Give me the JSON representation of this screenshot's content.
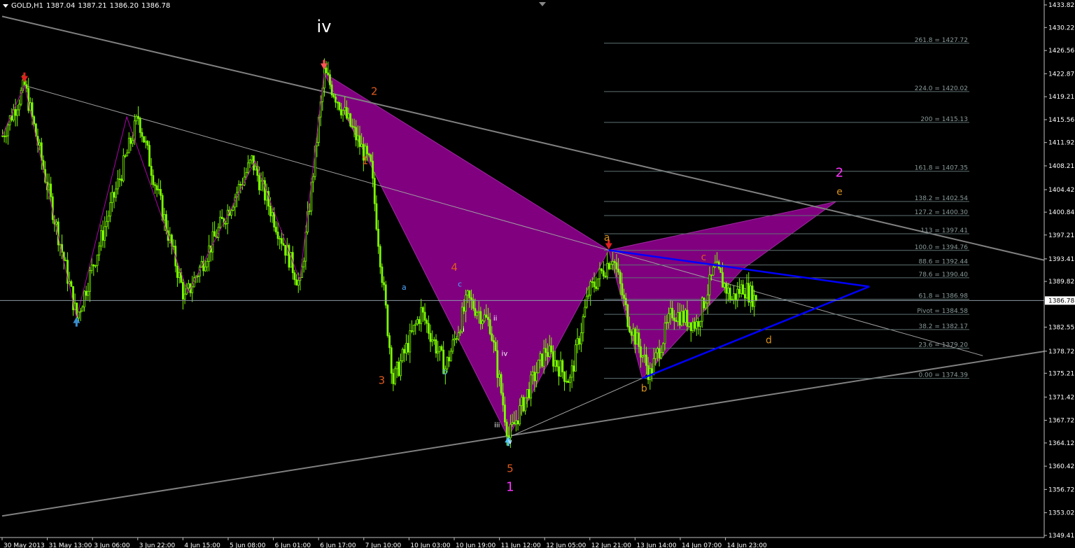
{
  "header": {
    "symbol": "GOLD,H1",
    "open": "1387.04",
    "high": "1387.21",
    "low": "1386.20",
    "close": "1386.78"
  },
  "colors": {
    "background": "#000000",
    "bull_candle": "#7CFC00",
    "harmonic_fill": "#800080",
    "trendline": "#808080",
    "triangle": "#0000FF",
    "fib_line": "#5f7272",
    "current_price_line": "#8c9aa6",
    "label_red": "#e05a1e",
    "label_orange": "#d9921a",
    "label_blue": "#4da6ff",
    "label_magenta": "#ff33ff",
    "arrow_red": "#e02020",
    "arrow_blue": "#3a8ccc",
    "arrow_cyan": "#4fc3f7"
  },
  "chart_data": {
    "type": "candlestick",
    "symbol": "GOLD",
    "timeframe": "H1",
    "ylim": [
      1349.41,
      1433.82
    ],
    "y_ticks": [
      "1433.82",
      "1430.22",
      "1426.56",
      "1422.87",
      "1419.21",
      "1415.56",
      "1411.92",
      "1408.21",
      "1404.42",
      "1400.84",
      "1397.21",
      "1393.41",
      "1389.82",
      "1386.78",
      "1382.55",
      "1378.72",
      "1375.21",
      "1371.42",
      "1367.72",
      "1364.12",
      "1360.42",
      "1356.72",
      "1353.02",
      "1349.41"
    ],
    "current_price": "1386.78",
    "x_ticks": [
      "30 May 2013",
      "31 May 13:00",
      "3 Jun 06:00",
      "3 Jun 22:00",
      "4 Jun 15:00",
      "5 Jun 08:00",
      "6 Jun 01:00",
      "6 Jun 17:00",
      "7 Jun 10:00",
      "10 Jun 03:00",
      "10 Jun 19:00",
      "11 Jun 12:00",
      "12 Jun 05:00",
      "12 Jun 21:00",
      "13 Jun 14:00",
      "14 Jun 07:00",
      "14 Jun 23:00"
    ],
    "price_path": [
      {
        "bar": 0,
        "price": 1413
      },
      {
        "bar": 12,
        "price": 1421
      },
      {
        "bar": 40,
        "price": 1384
      },
      {
        "bar": 73,
        "price": 1416
      },
      {
        "bar": 98,
        "price": 1387
      },
      {
        "bar": 134,
        "price": 1409
      },
      {
        "bar": 160,
        "price": 1389
      },
      {
        "bar": 173,
        "price": 1423
      },
      {
        "bar": 198,
        "price": 1408
      },
      {
        "bar": 205,
        "price": 1388
      },
      {
        "bar": 210,
        "price": 1374
      },
      {
        "bar": 225,
        "price": 1385
      },
      {
        "bar": 238,
        "price": 1376
      },
      {
        "bar": 250,
        "price": 1387
      },
      {
        "bar": 262,
        "price": 1383
      },
      {
        "bar": 272,
        "price": 1365
      },
      {
        "bar": 292,
        "price": 1379
      },
      {
        "bar": 305,
        "price": 1374
      },
      {
        "bar": 315,
        "price": 1388
      },
      {
        "bar": 328,
        "price": 1394
      },
      {
        "bar": 336,
        "price": 1384
      },
      {
        "bar": 348,
        "price": 1375
      },
      {
        "bar": 360,
        "price": 1385
      },
      {
        "bar": 373,
        "price": 1383
      },
      {
        "bar": 383,
        "price": 1392
      },
      {
        "bar": 392,
        "price": 1387
      },
      {
        "bar": 398,
        "price": 1389
      },
      {
        "bar": 405,
        "price": 1386.78
      }
    ],
    "fib_levels": [
      {
        "label": "261.8 = 1427.72",
        "price": 1427.72
      },
      {
        "label": "224.0 = 1420.02",
        "price": 1420.02
      },
      {
        "label": "200 = 1415.13",
        "price": 1415.13
      },
      {
        "label": "161.8 = 1407.35",
        "price": 1407.35
      },
      {
        "label": "138.2 = 1402.54",
        "price": 1402.54
      },
      {
        "label": "127.2 = 1400.30",
        "price": 1400.3
      },
      {
        "label": "113 = 1397.41",
        "price": 1397.41
      },
      {
        "label": "100.0 = 1394.76",
        "price": 1394.76
      },
      {
        "label": "88.6 = 1392.44",
        "price": 1392.44
      },
      {
        "label": "78.6 = 1390.40",
        "price": 1390.4
      },
      {
        "label": "61.8 = 1386.98",
        "price": 1386.98
      },
      {
        "label": "Pivot = 1384.58",
        "price": 1384.58
      },
      {
        "label": "38.2 = 1382.17",
        "price": 1382.17
      },
      {
        "label": "23.6 = 1379.20",
        "price": 1379.2
      },
      {
        "label": "0.00 = 1374.39",
        "price": 1374.39
      }
    ],
    "wave_labels": [
      {
        "text": "iv",
        "bar": 173,
        "price": 1429.5,
        "color": "#ffffff",
        "size": 24
      },
      {
        "text": "2",
        "bar": 200,
        "price": 1419.5,
        "color": "#e05a1e",
        "size": 15
      },
      {
        "text": "1",
        "bar": 195,
        "price": 1408.5,
        "color": "#e05a1e",
        "size": 15
      },
      {
        "text": "3",
        "bar": 204,
        "price": 1373.5,
        "color": "#e05a1e",
        "size": 15
      },
      {
        "text": "4",
        "bar": 243,
        "price": 1391.5,
        "color": "#e05a1e",
        "size": 15
      },
      {
        "text": "5",
        "bar": 273,
        "price": 1359.5,
        "color": "#e05a1e",
        "size": 15
      },
      {
        "text": "1",
        "bar": 273,
        "price": 1356.5,
        "color": "#ff33ff",
        "size": 18
      },
      {
        "text": "2",
        "bar": 450,
        "price": 1406.5,
        "color": "#ff33ff",
        "size": 18
      },
      {
        "text": "a",
        "bar": 216,
        "price": 1388.5,
        "color": "#4da6ff",
        "size": 11
      },
      {
        "text": "c",
        "bar": 246,
        "price": 1389.0,
        "color": "#4da6ff",
        "size": 11
      },
      {
        "text": "b",
        "bar": 238,
        "price": 1375.0,
        "color": "#4da6ff",
        "size": 11
      },
      {
        "text": "i",
        "bar": 248,
        "price": 1381.8,
        "color": "#ffffff",
        "size": 10
      },
      {
        "text": "ii",
        "bar": 265,
        "price": 1383.6,
        "color": "#ffffff",
        "size": 10
      },
      {
        "text": "iii",
        "bar": 266,
        "price": 1366.6,
        "color": "#ffffff",
        "size": 10
      },
      {
        "text": "iv",
        "bar": 270,
        "price": 1378.0,
        "color": "#ffffff",
        "size": 10
      },
      {
        "text": "v",
        "bar": 273,
        "price": 1364.0,
        "color": "#ffffff",
        "size": 10
      },
      {
        "text": "a",
        "bar": 325,
        "price": 1396.3,
        "color": "#d9921a",
        "size": 14
      },
      {
        "text": "b",
        "bar": 345,
        "price": 1372.3,
        "color": "#d9921a",
        "size": 14
      },
      {
        "text": "c",
        "bar": 377,
        "price": 1393.2,
        "color": "#e05a1e",
        "size": 14
      },
      {
        "text": "d",
        "bar": 412,
        "price": 1380.0,
        "color": "#d9921a",
        "size": 14
      },
      {
        "text": "e",
        "bar": 450,
        "price": 1403.6,
        "color": "#d9921a",
        "size": 14
      }
    ],
    "harmonic_patterns": [
      {
        "points": [
          {
            "bar": 173,
            "price": 1423
          },
          {
            "bar": 272,
            "price": 1365
          },
          {
            "bar": 200,
            "price": 1417
          }
        ]
      },
      {
        "points": [
          {
            "bar": 173,
            "price": 1423
          },
          {
            "bar": 272,
            "price": 1365
          },
          {
            "bar": 326,
            "price": 1394.8
          }
        ]
      },
      {
        "points": [
          {
            "bar": 326,
            "price": 1394.8
          },
          {
            "bar": 344,
            "price": 1374.4
          },
          {
            "bar": 398,
            "price": 1391.8
          }
        ]
      },
      {
        "points": [
          {
            "bar": 326,
            "price": 1394.8
          },
          {
            "bar": 448,
            "price": 1402.5
          },
          {
            "bar": 398,
            "price": 1391.8
          }
        ]
      }
    ],
    "trendlines": [
      {
        "from": {
          "bar": 0,
          "price": 1432
        },
        "to": {
          "bar": 560,
          "price": 1393.2
        },
        "color": "#808080",
        "width": 2
      },
      {
        "from": {
          "bar": 0,
          "price": 1352.5
        },
        "to": {
          "bar": 560,
          "price": 1378.7
        },
        "color": "#808080",
        "width": 2
      },
      {
        "from": {
          "bar": 12,
          "price": 1421
        },
        "to": {
          "bar": 527,
          "price": 1378.0
        },
        "color": "#a0a0a0",
        "width": 1
      },
      {
        "from": {
          "bar": 272,
          "price": 1365
        },
        "to": {
          "bar": 344,
          "price": 1374.4
        },
        "color": "#a0a0a0",
        "width": 1
      }
    ],
    "zigzag": [
      {
        "bar": 0,
        "price": 1413
      },
      {
        "bar": 12,
        "price": 1421
      },
      {
        "bar": 40,
        "price": 1384
      },
      {
        "bar": 67,
        "price": 1416
      },
      {
        "bar": 100,
        "price": 1388
      },
      {
        "bar": 136,
        "price": 1409
      },
      {
        "bar": 160,
        "price": 1390
      },
      {
        "bar": 173,
        "price": 1423
      }
    ],
    "triangle_lines": [
      {
        "from": {
          "bar": 326,
          "price": 1394.8
        },
        "to": {
          "bar": 466,
          "price": 1389.0
        }
      },
      {
        "from": {
          "bar": 344,
          "price": 1374.4
        },
        "to": {
          "bar": 466,
          "price": 1389.0
        }
      }
    ],
    "arrows": [
      {
        "bar": 12,
        "price": 1421.5,
        "direction": "down",
        "color": "#e02020"
      },
      {
        "bar": 40,
        "price": 1384.2,
        "direction": "up",
        "color": "#3a8ccc"
      },
      {
        "bar": 173,
        "price": 1423.5,
        "direction": "down",
        "color": "#ff5555"
      },
      {
        "bar": 272,
        "price": 1365.2,
        "direction": "up",
        "color": "#4fc3f7"
      },
      {
        "bar": 326,
        "price": 1394.9,
        "direction": "down",
        "color": "#e02020"
      }
    ]
  }
}
